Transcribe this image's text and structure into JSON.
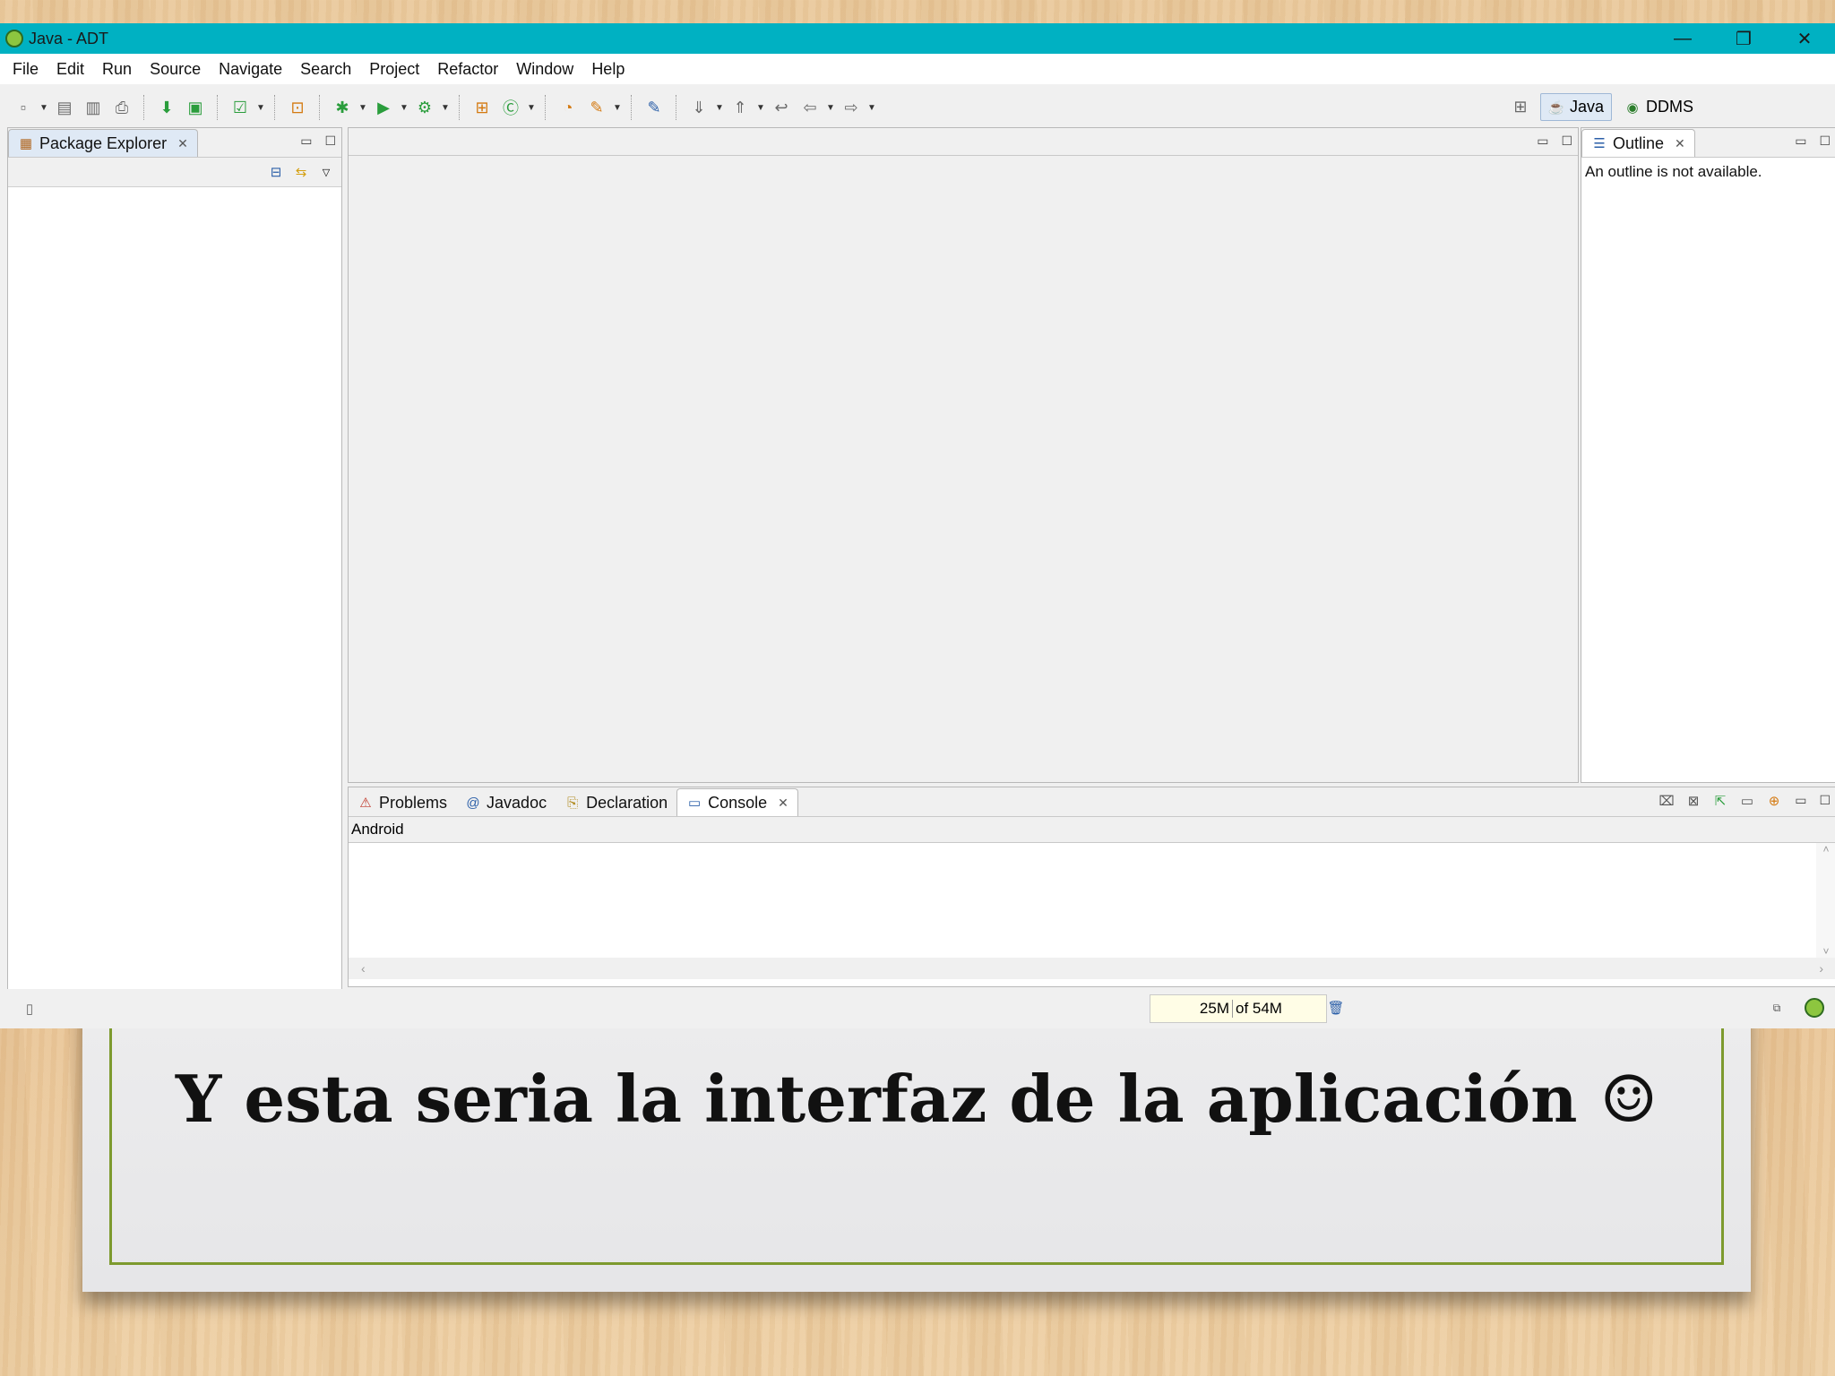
{
  "window": {
    "title": "Java - ADT",
    "controls": {
      "minimize": "—",
      "restore": "❐",
      "close": "✕"
    }
  },
  "menu": [
    "File",
    "Edit",
    "Run",
    "Source",
    "Navigate",
    "Search",
    "Project",
    "Refactor",
    "Window",
    "Help"
  ],
  "perspectives": {
    "java": "Java",
    "ddms": "DDMS"
  },
  "package_explorer": {
    "tab": "Package Explorer"
  },
  "outline": {
    "tab": "Outline",
    "message": "An outline is not available."
  },
  "bottom_tabs": {
    "problems": "Problems",
    "javadoc": "Javadoc",
    "declaration": "Declaration",
    "console": "Console"
  },
  "console": {
    "header": "Android"
  },
  "status": {
    "heap_used": "25M",
    "heap_total": "of 54M"
  },
  "slide": {
    "caption": "Y esta seria la interfaz de la aplicación ☺"
  },
  "colors": {
    "titlebar": "#00b1c2",
    "frame": "#7d9a2e"
  }
}
